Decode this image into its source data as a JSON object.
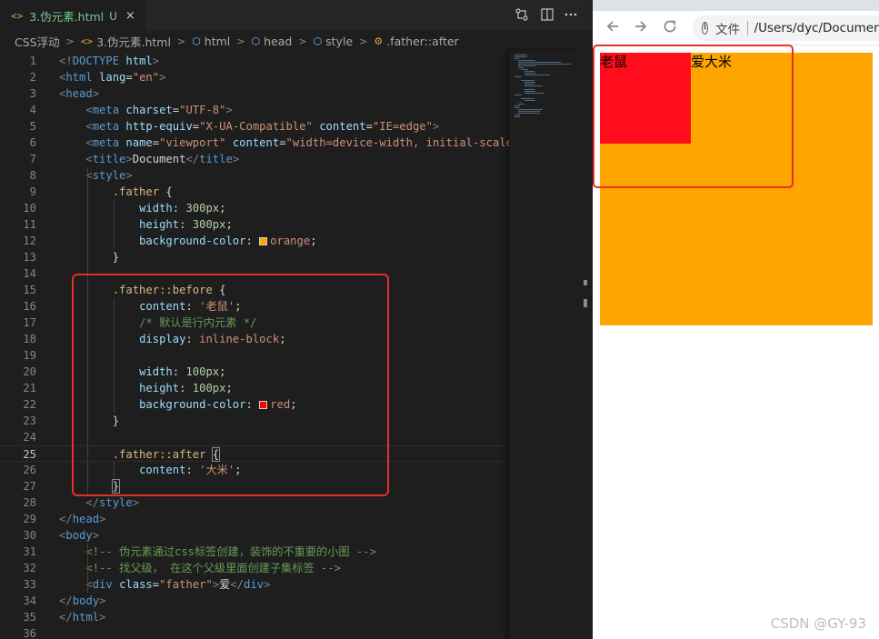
{
  "editor": {
    "tab": {
      "icon": "<>",
      "filename": "3.伪元素.html",
      "state": "U",
      "close": "×"
    },
    "breadcrumb": {
      "folder": "CSS浮动",
      "file": "3.伪元素.html",
      "items": [
        "html",
        "head",
        "style",
        ".father::after"
      ]
    },
    "active_line": 25,
    "lines": [
      [
        [
          "t-br",
          "<!"
        ],
        [
          "t-tag",
          "DOCTYPE"
        ],
        [
          "t-txt",
          " "
        ],
        [
          "t-attr",
          "html"
        ],
        [
          "t-br",
          ">"
        ]
      ],
      [
        [
          "t-br",
          "<"
        ],
        [
          "t-tag",
          "html"
        ],
        [
          "t-txt",
          " "
        ],
        [
          "t-attr",
          "lang"
        ],
        [
          "t-txt",
          "="
        ],
        [
          "t-str",
          "\"en\""
        ],
        [
          "t-br",
          ">"
        ]
      ],
      [
        [
          "t-br",
          "<"
        ],
        [
          "t-tag",
          "head"
        ],
        [
          "t-br",
          ">"
        ]
      ],
      [
        [
          "t-txt",
          "    "
        ],
        [
          "t-br",
          "<"
        ],
        [
          "t-tag",
          "meta"
        ],
        [
          "t-txt",
          " "
        ],
        [
          "t-attr",
          "charset"
        ],
        [
          "t-txt",
          "="
        ],
        [
          "t-str",
          "\"UTF-8\""
        ],
        [
          "t-br",
          ">"
        ]
      ],
      [
        [
          "t-txt",
          "    "
        ],
        [
          "t-br",
          "<"
        ],
        [
          "t-tag",
          "meta"
        ],
        [
          "t-txt",
          " "
        ],
        [
          "t-attr",
          "http-equiv"
        ],
        [
          "t-txt",
          "="
        ],
        [
          "t-str",
          "\"X-UA-Compatible\""
        ],
        [
          "t-txt",
          " "
        ],
        [
          "t-attr",
          "content"
        ],
        [
          "t-txt",
          "="
        ],
        [
          "t-str",
          "\"IE=edge\""
        ],
        [
          "t-br",
          ">"
        ]
      ],
      [
        [
          "t-txt",
          "    "
        ],
        [
          "t-br",
          "<"
        ],
        [
          "t-tag",
          "meta"
        ],
        [
          "t-txt",
          " "
        ],
        [
          "t-attr",
          "name"
        ],
        [
          "t-txt",
          "="
        ],
        [
          "t-str",
          "\"viewport\""
        ],
        [
          "t-txt",
          " "
        ],
        [
          "t-attr",
          "content"
        ],
        [
          "t-txt",
          "="
        ],
        [
          "t-str",
          "\"width=device-width, initial-scale="
        ]
      ],
      [
        [
          "t-txt",
          "    "
        ],
        [
          "t-br",
          "<"
        ],
        [
          "t-tag",
          "title"
        ],
        [
          "t-br",
          ">"
        ],
        [
          "t-txt",
          "Document"
        ],
        [
          "t-br",
          "</"
        ],
        [
          "t-tag",
          "title"
        ],
        [
          "t-br",
          ">"
        ]
      ],
      [
        [
          "t-txt",
          "    "
        ],
        [
          "t-br",
          "<"
        ],
        [
          "t-tag",
          "style"
        ],
        [
          "t-br",
          ">"
        ]
      ],
      [
        [
          "t-txt",
          "        "
        ],
        [
          "t-sel",
          ".father"
        ],
        [
          "t-txt",
          " {"
        ]
      ],
      [
        [
          "t-txt",
          "            "
        ],
        [
          "t-prop",
          "width"
        ],
        [
          "t-txt",
          ": "
        ],
        [
          "t-num",
          "300px"
        ],
        [
          "t-txt",
          ";"
        ]
      ],
      [
        [
          "t-txt",
          "            "
        ],
        [
          "t-prop",
          "height"
        ],
        [
          "t-txt",
          ": "
        ],
        [
          "t-num",
          "300px"
        ],
        [
          "t-txt",
          ";"
        ]
      ],
      [
        [
          "t-txt",
          "            "
        ],
        [
          "t-prop",
          "background-color"
        ],
        [
          "t-txt",
          ": "
        ],
        [
          "swatch",
          "orange"
        ],
        [
          "t-str",
          "orange"
        ],
        [
          "t-txt",
          ";"
        ]
      ],
      [
        [
          "t-txt",
          "        }"
        ]
      ],
      [],
      [
        [
          "t-txt",
          "        "
        ],
        [
          "t-sel",
          ".father::before"
        ],
        [
          "t-txt",
          " {"
        ]
      ],
      [
        [
          "t-txt",
          "            "
        ],
        [
          "t-prop",
          "content"
        ],
        [
          "t-txt",
          ": "
        ],
        [
          "t-str",
          "'老鼠'"
        ],
        [
          "t-txt",
          ";"
        ]
      ],
      [
        [
          "t-txt",
          "            "
        ],
        [
          "t-com",
          "/* 默认是行内元素 */"
        ]
      ],
      [
        [
          "t-txt",
          "            "
        ],
        [
          "t-prop",
          "display"
        ],
        [
          "t-txt",
          ": "
        ],
        [
          "t-str",
          "inline-block"
        ],
        [
          "t-txt",
          ";"
        ]
      ],
      [],
      [
        [
          "t-txt",
          "            "
        ],
        [
          "t-prop",
          "width"
        ],
        [
          "t-txt",
          ": "
        ],
        [
          "t-num",
          "100px"
        ],
        [
          "t-txt",
          ";"
        ]
      ],
      [
        [
          "t-txt",
          "            "
        ],
        [
          "t-prop",
          "height"
        ],
        [
          "t-txt",
          ": "
        ],
        [
          "t-num",
          "100px"
        ],
        [
          "t-txt",
          ";"
        ]
      ],
      [
        [
          "t-txt",
          "            "
        ],
        [
          "t-prop",
          "background-color"
        ],
        [
          "t-txt",
          ": "
        ],
        [
          "swatch",
          "red"
        ],
        [
          "t-str",
          "red"
        ],
        [
          "t-txt",
          ";"
        ]
      ],
      [
        [
          "t-txt",
          "        }"
        ]
      ],
      [],
      [
        [
          "t-txt",
          "        "
        ],
        [
          "t-sel",
          ".father::after"
        ],
        [
          "t-txt",
          " "
        ],
        [
          "bm",
          "{"
        ]
      ],
      [
        [
          "t-txt",
          "            "
        ],
        [
          "t-prop",
          "content"
        ],
        [
          "t-txt",
          ": "
        ],
        [
          "t-str",
          "'大米'"
        ],
        [
          "t-txt",
          ";"
        ]
      ],
      [
        [
          "t-txt",
          "        "
        ],
        [
          "bm",
          "}"
        ]
      ],
      [
        [
          "t-txt",
          "    "
        ],
        [
          "t-br",
          "</"
        ],
        [
          "t-tag",
          "style"
        ],
        [
          "t-br",
          ">"
        ]
      ],
      [
        [
          "t-br",
          "</"
        ],
        [
          "t-tag",
          "head"
        ],
        [
          "t-br",
          ">"
        ]
      ],
      [
        [
          "t-br",
          "<"
        ],
        [
          "t-tag",
          "body"
        ],
        [
          "t-br",
          ">"
        ]
      ],
      [
        [
          "t-txt",
          "    "
        ],
        [
          "t-com",
          "<!-- 伪元素通过css标签创建，装饰的不重要的小图 -->"
        ]
      ],
      [
        [
          "t-txt",
          "    "
        ],
        [
          "t-com",
          "<!-- 找父级， 在这个父级里面创建子集标签 -->"
        ]
      ],
      [
        [
          "t-txt",
          "    "
        ],
        [
          "t-br",
          "<"
        ],
        [
          "t-tag",
          "div"
        ],
        [
          "t-txt",
          " "
        ],
        [
          "t-attr",
          "class"
        ],
        [
          "t-txt",
          "="
        ],
        [
          "t-str",
          "\"father\""
        ],
        [
          "t-br",
          ">"
        ],
        [
          "t-txt",
          "爱"
        ],
        [
          "t-br",
          "</"
        ],
        [
          "t-tag",
          "div"
        ],
        [
          "t-br",
          ">"
        ]
      ],
      [
        [
          "t-br",
          "</"
        ],
        [
          "t-tag",
          "body"
        ],
        [
          "t-br",
          ">"
        ]
      ],
      [
        [
          "t-br",
          "</"
        ],
        [
          "t-tag",
          "html"
        ],
        [
          "t-br",
          ">"
        ]
      ],
      []
    ],
    "colors": {
      "background": "#1e1e1e",
      "highlight_box": "#e5312b",
      "modified": "#73c991"
    }
  },
  "browser": {
    "address": {
      "scheme": "文件",
      "url": "/Users/dyc/Documents"
    },
    "page": {
      "before_text": "老鼠",
      "after_text": "爱大米",
      "father_color": "orange",
      "before_color": "#ff0d1c"
    }
  },
  "watermark": "CSDN @GY-93"
}
